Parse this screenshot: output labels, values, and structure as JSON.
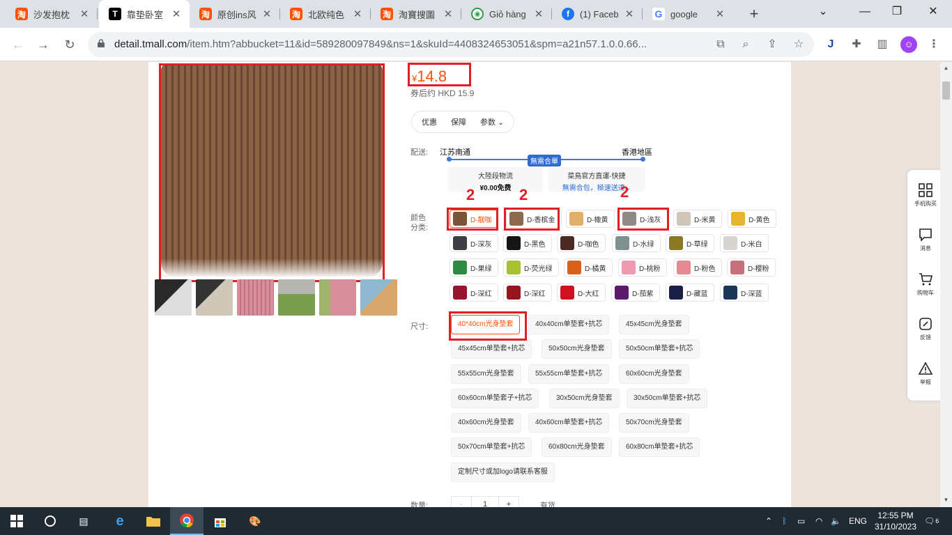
{
  "browser": {
    "tabs": [
      {
        "title": "沙发抱枕",
        "favicon": "taobao-icon",
        "glyph": "淘"
      },
      {
        "title": "靠垫卧室",
        "favicon": "tmall-icon",
        "glyph": "T"
      },
      {
        "title": "原创ins风",
        "favicon": "taobao-icon",
        "glyph": "淘"
      },
      {
        "title": "北欧纯色",
        "favicon": "taobao-icon",
        "glyph": "淘"
      },
      {
        "title": "淘寶搜圖",
        "favicon": "taobao-icon",
        "glyph": "淘"
      },
      {
        "title": "Giỏ hàng",
        "favicon": "cart-icon",
        "glyph": "🛒"
      },
      {
        "title": "(1) Faceb",
        "favicon": "facebook-icon",
        "glyph": "f"
      },
      {
        "title": "google",
        "favicon": "google-icon",
        "glyph": "G"
      }
    ],
    "url_host": "detail.tmall.com",
    "url_path": "/item.htm?abbucket=11&id=589280097849&ns=1&skuId=4408324653051&spm=a21n57.1.0.0.66..."
  },
  "product": {
    "price_currency": "¥",
    "price": "14.8",
    "coupon_price": "券后约 HKD 15.9",
    "pills": [
      "优惠",
      "保障",
      "参数"
    ],
    "shipping": {
      "label": "配送:",
      "from": "江苏南通",
      "to": "香港地區",
      "badge": "無需合單",
      "box1_title": "大陸段物流",
      "box1_sub": "¥0.00免费",
      "box2_title": "菜鳥官方直運-快捷",
      "box2_sub": "無需合包，極速送達",
      "box2_chevron": "⌄"
    },
    "annotations": [
      "2",
      "2",
      "2"
    ],
    "color_label": "颜色分类:",
    "colors": [
      {
        "name": "D-靓咖",
        "color": "#7a5436"
      },
      {
        "name": "D-香槟金",
        "color": "#8d6a4f"
      },
      {
        "name": "D-橄黄",
        "color": "#e0b06a"
      },
      {
        "name": "D-浅灰",
        "color": "#8f8a86"
      },
      {
        "name": "D-米黄",
        "color": "#cfc5b8"
      },
      {
        "name": "D-黄色",
        "color": "#e6b72a"
      },
      {
        "name": "D-深灰",
        "color": "#3e3f44"
      },
      {
        "name": "D-黑色",
        "color": "#151515"
      },
      {
        "name": "D-咖色",
        "color": "#4a2a22"
      },
      {
        "name": "D-水绿",
        "color": "#7f918f"
      },
      {
        "name": "D-草绿",
        "color": "#8a7a25"
      },
      {
        "name": "D-米白",
        "color": "#d7d4cf"
      },
      {
        "name": "D-果绿",
        "color": "#2f8a3f"
      },
      {
        "name": "D-荧光绿",
        "color": "#a7c230"
      },
      {
        "name": "D-橘黄",
        "color": "#d9621a"
      },
      {
        "name": "D-桃粉",
        "color": "#ee9ab1"
      },
      {
        "name": "D-粉色",
        "color": "#e58a92"
      },
      {
        "name": "D-樱粉",
        "color": "#c7717d"
      },
      {
        "name": "D-深红",
        "color": "#9a1430"
      },
      {
        "name": "D-深红",
        "color": "#9a1420"
      },
      {
        "name": "D-大红",
        "color": "#d01020"
      },
      {
        "name": "D-茄紫",
        "color": "#5b1a6b"
      },
      {
        "name": "D-藏蓝",
        "color": "#1b1f48"
      },
      {
        "name": "D-深蓝",
        "color": "#1d3556"
      }
    ],
    "size_label": "尺寸:",
    "sizes": [
      "40*40cm光身垫套",
      "40x40cm单垫套+抗芯",
      "45x45cm光身垫套",
      "45x45cm单垫套+抗芯",
      "50x50cm光身垫套",
      "50x50cm单垫套+抗芯",
      "55x55cm光身垫套",
      "55x55cm单垫套+抗芯",
      "60x60cm光身垫套",
      "60x60cm单垫套子+抗芯",
      "30x50cm光身垫套",
      "30x50cm单垫套+抗芯",
      "40x60cm光身垫套",
      "40x60cm单垫套+抗芯",
      "50x70cm光身垫套",
      "50x70cm单垫套+抗芯",
      "60x80cm光身垫套",
      "60x80cm单垫套+抗芯",
      "定制尺寸或加logo请联系客服"
    ],
    "quantity_label": "数量:",
    "quantity": "1",
    "minus": "-",
    "plus": "+",
    "stock": "有货"
  },
  "floatbar": [
    {
      "label": "手机购买",
      "icon": "qrcode-icon"
    },
    {
      "label": "消息",
      "icon": "message-icon"
    },
    {
      "label": "购物车",
      "icon": "cart-icon"
    },
    {
      "label": "反馈",
      "icon": "edit-icon"
    },
    {
      "label": "举报",
      "icon": "warning-icon"
    }
  ],
  "taskbar": {
    "language": "ENG",
    "time": "12:55 PM",
    "date": "31/10/2023",
    "notifications": "6"
  },
  "colors": {
    "accent": "#ff5000",
    "annotation": "#e01e25",
    "link": "#2d6bd3"
  }
}
